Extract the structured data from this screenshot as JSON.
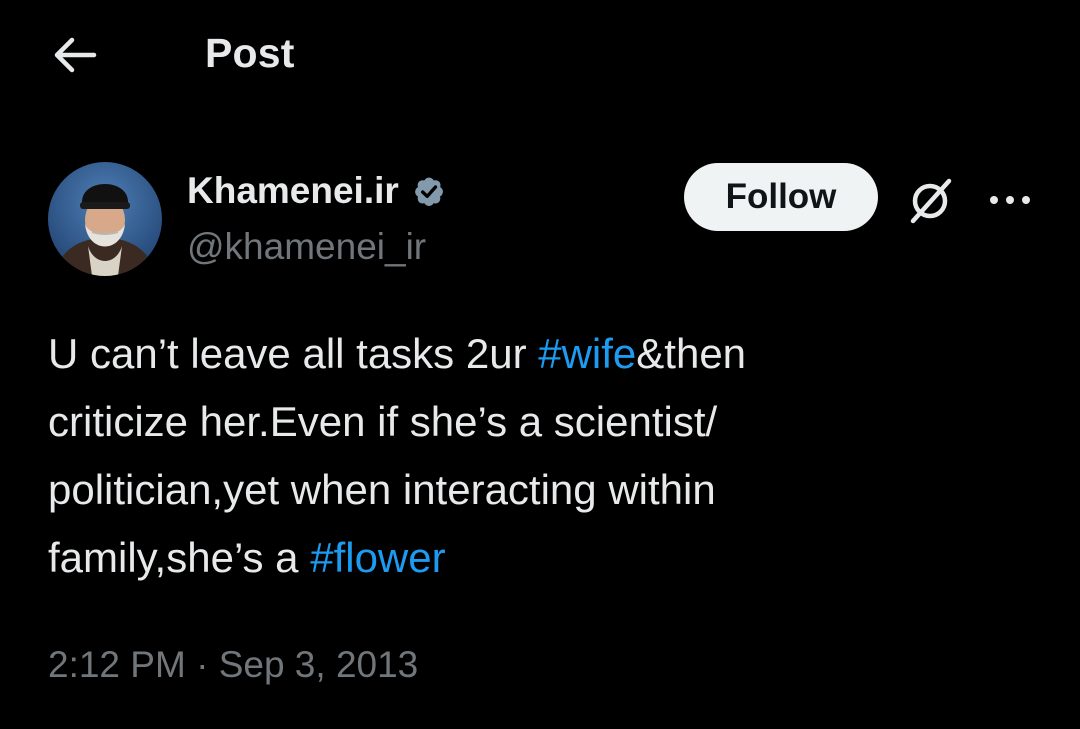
{
  "header": {
    "title": "Post",
    "back_icon": "arrow-left-icon"
  },
  "author": {
    "name": "Khamenei.ir",
    "handle": "@khamenei_ir",
    "verified": true,
    "verified_color": "#71767b"
  },
  "actions": {
    "follow_label": "Follow",
    "grok_icon": "grok-icon",
    "more_icon": "more-horizontal-icon"
  },
  "post": {
    "line1_text": "U can’t leave all tasks 2ur ",
    "line1_hashtag": "#wife",
    "line1_text_after": "&then",
    "line2_text": "criticize her.Even if she’s a scientist/",
    "line3_text": "politician,yet when interacting within",
    "line4_text": "family,she’s a ",
    "line4_hashtag": "#flower"
  },
  "meta": {
    "time": "2:12 PM",
    "separator": " · ",
    "date": "Sep 3, 2013"
  },
  "colors": {
    "background": "#000000",
    "text": "#e7e9ea",
    "secondary": "#71767b",
    "link": "#1d9bf0",
    "follow_bg": "#eff3f4"
  }
}
